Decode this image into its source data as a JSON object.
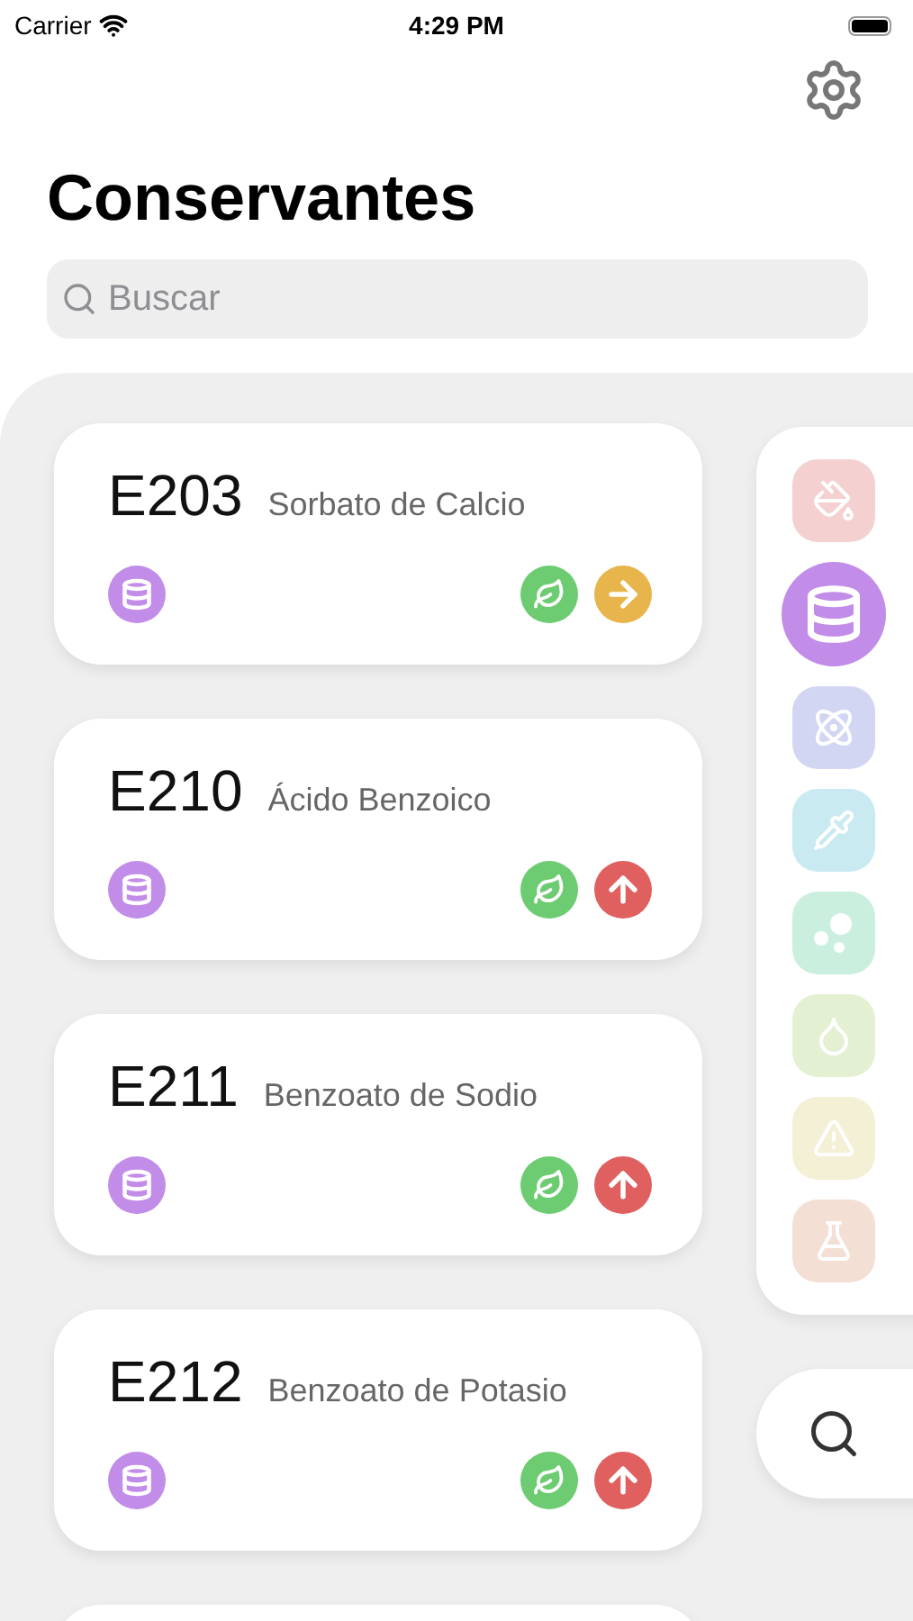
{
  "status_bar": {
    "carrier": "Carrier",
    "time": "4:29 PM"
  },
  "title": "Conservantes",
  "search": {
    "placeholder": "Buscar"
  },
  "additives": [
    {
      "code": "E203",
      "name": "Sorbato de Calcio",
      "category": {
        "kind": "database"
      },
      "badges": [
        {
          "kind": "leaf"
        },
        {
          "kind": "arrow_right"
        }
      ]
    },
    {
      "code": "E210",
      "name": "Ácido Benzoico",
      "category": {
        "kind": "database"
      },
      "badges": [
        {
          "kind": "leaf"
        },
        {
          "kind": "arrow_up"
        }
      ]
    },
    {
      "code": "E211",
      "name": "Benzoato de Sodio",
      "category": {
        "kind": "database"
      },
      "badges": [
        {
          "kind": "leaf"
        },
        {
          "kind": "arrow_up"
        }
      ]
    },
    {
      "code": "E212",
      "name": "Benzoato de Potasio",
      "category": {
        "kind": "database"
      },
      "badges": [
        {
          "kind": "leaf"
        },
        {
          "kind": "arrow_up"
        }
      ]
    }
  ],
  "categories": [
    {
      "kind": "paint",
      "color": "#f5d0d1",
      "selected": false
    },
    {
      "kind": "database",
      "color": "#c28de9",
      "selected": true
    },
    {
      "kind": "atom",
      "color": "#d3d6f3",
      "selected": false
    },
    {
      "kind": "dropper",
      "color": "#c9eaf1",
      "selected": false
    },
    {
      "kind": "bubbles",
      "color": "#cbefdf",
      "selected": false
    },
    {
      "kind": "drop",
      "color": "#e3f1d2",
      "selected": false
    },
    {
      "kind": "warning",
      "color": "#f4f0d5",
      "selected": false
    },
    {
      "kind": "flask",
      "color": "#f3dfd3",
      "selected": false
    }
  ]
}
